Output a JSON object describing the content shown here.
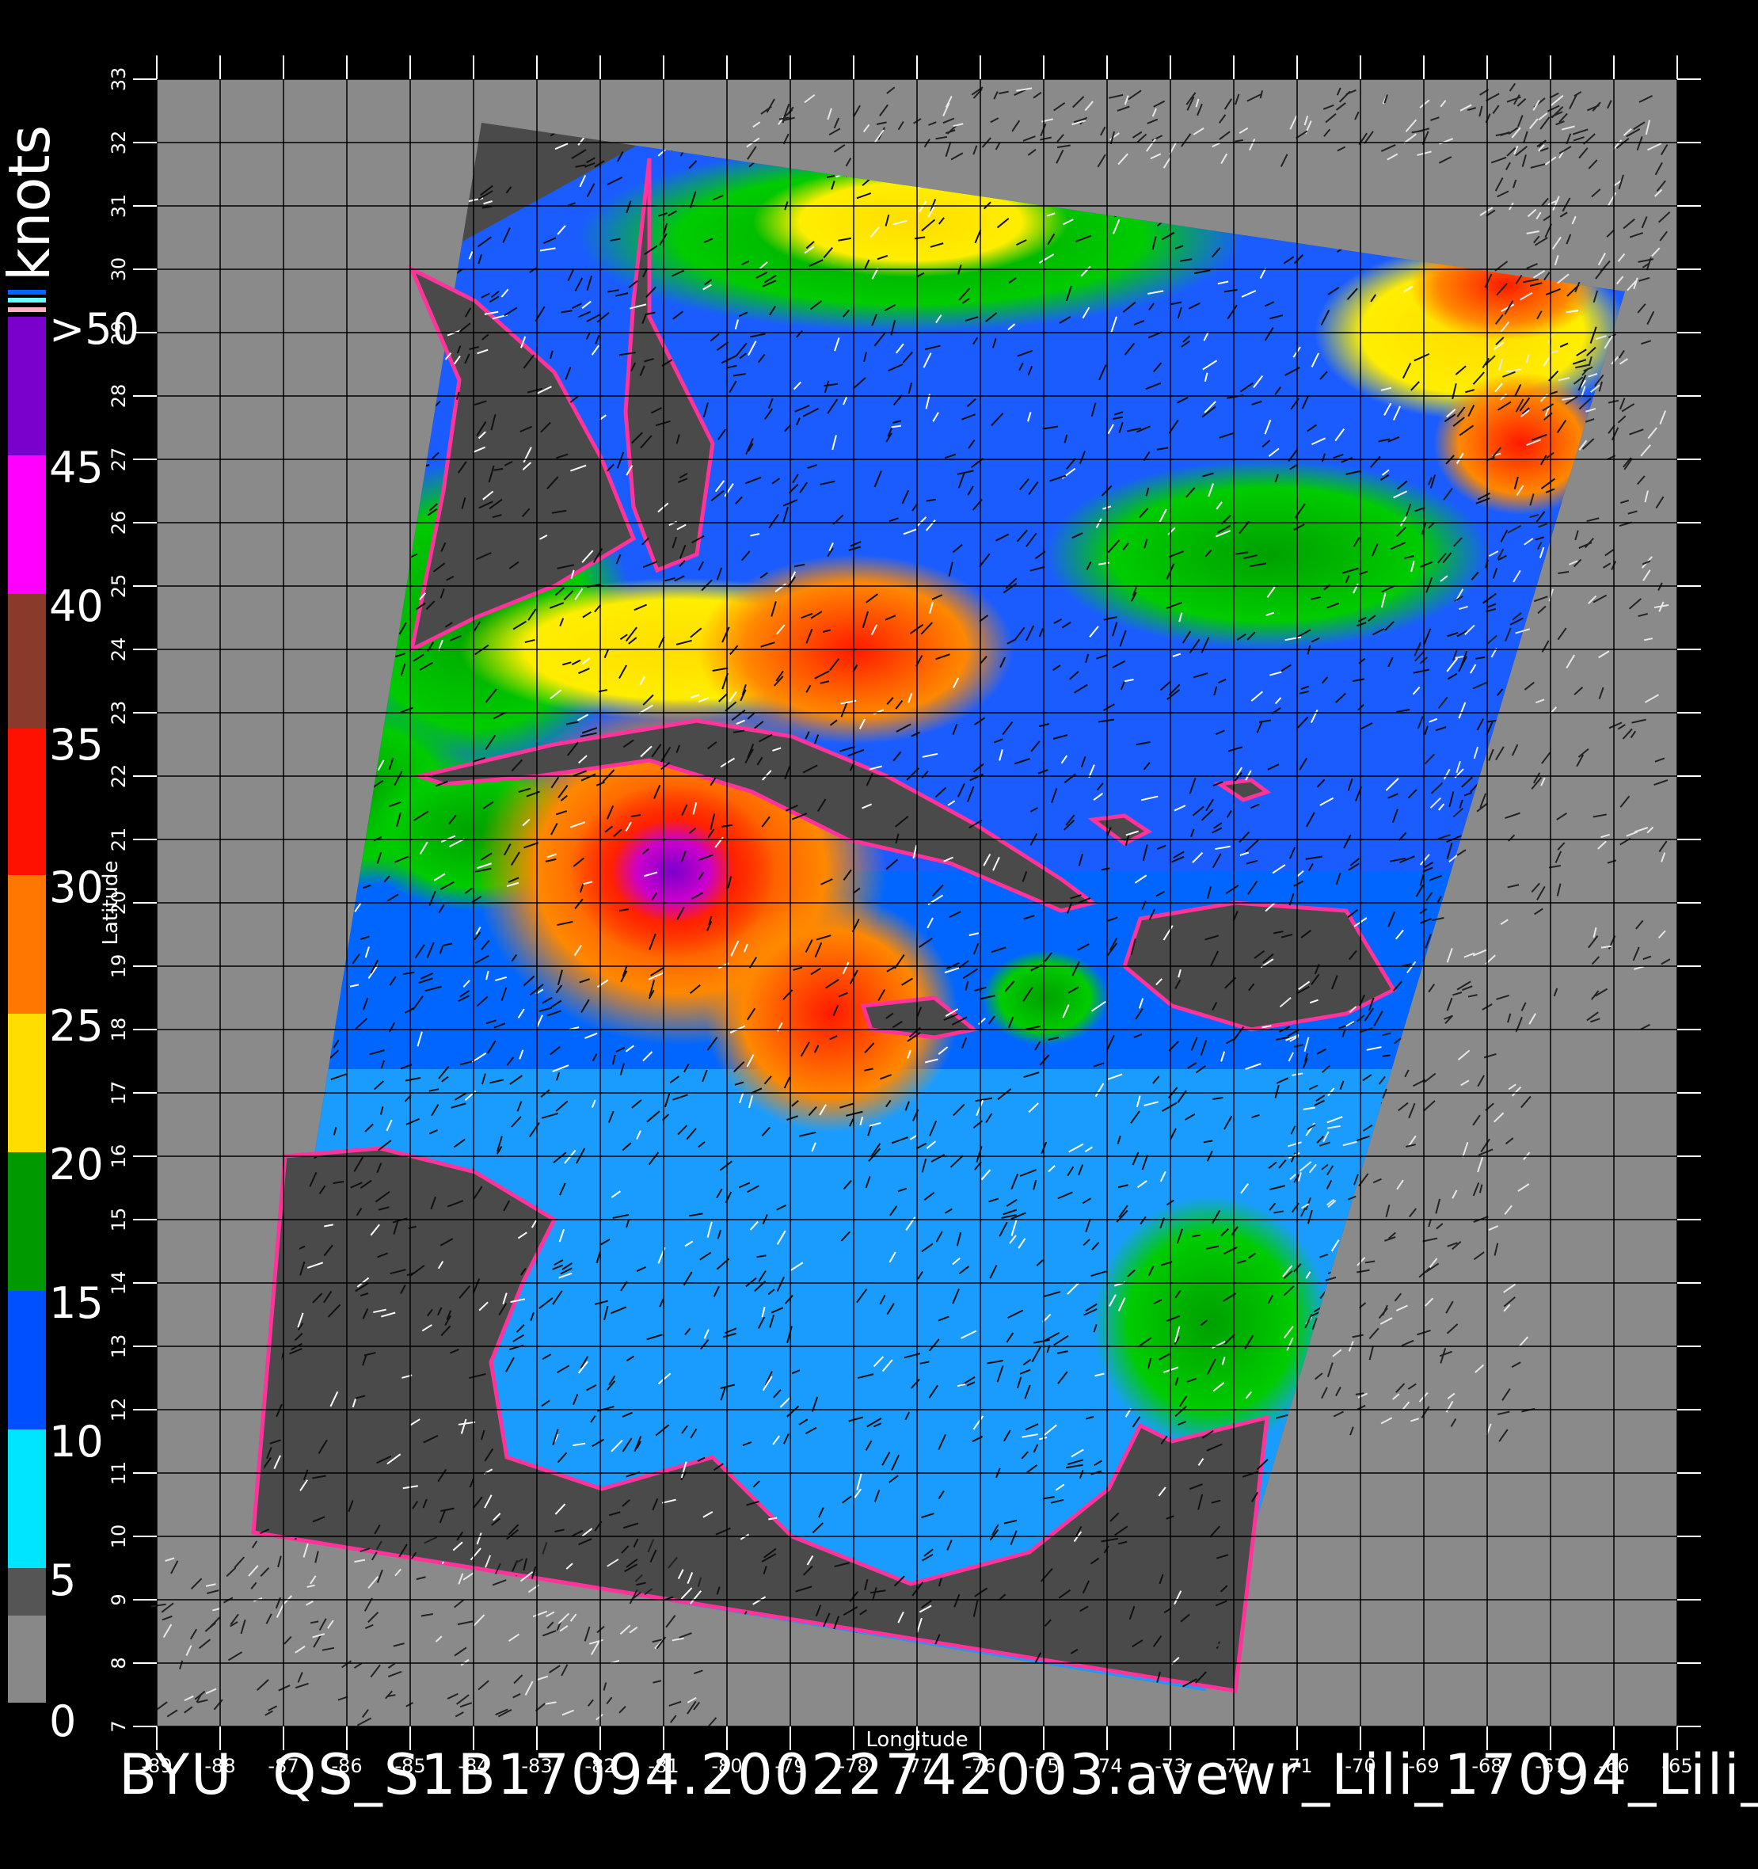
{
  "colorbar": {
    "unit": "knots",
    "labels": [
      "0",
      "5",
      "10",
      "15",
      "20",
      "25",
      "30",
      "35",
      "40",
      "45",
      ">50"
    ]
  },
  "axes": {
    "xlabel": "Longitude",
    "ylabel": "Latitude",
    "lon_ticks": [
      "-89",
      "-88",
      "-87",
      "-86",
      "-85",
      "-84",
      "-83",
      "-82",
      "-81",
      "-80",
      "-79",
      "-78",
      "-77",
      "-76",
      "-75",
      "-74",
      "-73",
      "-72",
      "-71",
      "-70",
      "-69",
      "-68",
      "-67",
      "-66",
      "-65"
    ],
    "lat_ticks": [
      "7",
      "8",
      "9",
      "10",
      "11",
      "12",
      "13",
      "14",
      "15",
      "16",
      "17",
      "18",
      "19",
      "20",
      "21",
      "22",
      "23",
      "24",
      "25",
      "26",
      "27",
      "28",
      "29",
      "30",
      "31",
      "32",
      "33"
    ]
  },
  "footer": {
    "org": "BYU",
    "filename": "QS_S1B17094.20022742003.avewr_Lili_17094_Lili_"
  }
}
